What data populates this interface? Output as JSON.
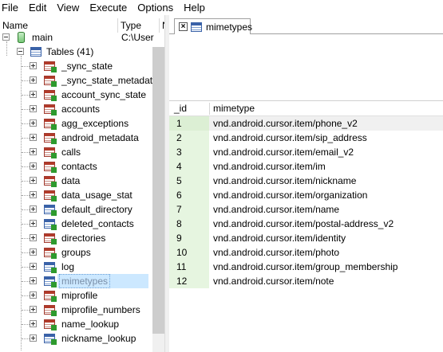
{
  "menu": [
    "File",
    "Edit",
    "View",
    "Execute",
    "Options",
    "Help"
  ],
  "tree_header": {
    "name": "Name",
    "type": "Type",
    "extra": "N"
  },
  "tree": {
    "db": {
      "label": "main",
      "type": "C:\\User"
    },
    "tables_node": "Tables (41)",
    "tables": [
      {
        "label": "_sync_state",
        "icon": "table-icon-red"
      },
      {
        "label": "_sync_state_metadata",
        "icon": "table-icon-red"
      },
      {
        "label": "account_sync_state",
        "icon": "table-icon-red"
      },
      {
        "label": "accounts",
        "icon": "table-icon-red"
      },
      {
        "label": "agg_exceptions",
        "icon": "table-icon-red"
      },
      {
        "label": "android_metadata",
        "icon": "table-icon-red"
      },
      {
        "label": "calls",
        "icon": "table-icon-red"
      },
      {
        "label": "contacts",
        "icon": "table-icon-red"
      },
      {
        "label": "data",
        "icon": "table-icon-red"
      },
      {
        "label": "data_usage_stat",
        "icon": "table-icon-red"
      },
      {
        "label": "default_directory",
        "icon": "table-icon-blue"
      },
      {
        "label": "deleted_contacts",
        "icon": "table-icon-blue"
      },
      {
        "label": "directories",
        "icon": "table-icon-red"
      },
      {
        "label": "groups",
        "icon": "table-icon-red"
      },
      {
        "label": "log",
        "icon": "table-icon-blue"
      },
      {
        "label": "mimetypes",
        "icon": "table-icon-blue",
        "selected": true
      },
      {
        "label": "miprofile",
        "icon": "table-icon-red"
      },
      {
        "label": "miprofile_numbers",
        "icon": "table-icon-red"
      },
      {
        "label": "name_lookup",
        "icon": "table-icon-red"
      },
      {
        "label": "nickname_lookup",
        "icon": "table-icon-blue"
      }
    ]
  },
  "tab": {
    "label": "mimetypes",
    "close_label": "×"
  },
  "grid": {
    "columns": [
      "_id",
      "mimetype"
    ],
    "rows": [
      [
        "1",
        "vnd.android.cursor.item/phone_v2"
      ],
      [
        "2",
        "vnd.android.cursor.item/sip_address"
      ],
      [
        "3",
        "vnd.android.cursor.item/email_v2"
      ],
      [
        "4",
        "vnd.android.cursor.item/im"
      ],
      [
        "5",
        "vnd.android.cursor.item/nickname"
      ],
      [
        "6",
        "vnd.android.cursor.item/organization"
      ],
      [
        "7",
        "vnd.android.cursor.item/name"
      ],
      [
        "8",
        "vnd.android.cursor.item/postal-address_v2"
      ],
      [
        "9",
        "vnd.android.cursor.item/identity"
      ],
      [
        "10",
        "vnd.android.cursor.item/photo"
      ],
      [
        "11",
        "vnd.android.cursor.item/group_membership"
      ],
      [
        "12",
        "vnd.android.cursor.item/note"
      ]
    ]
  },
  "colors": {
    "selection": "#cce8ff",
    "id_column": "#e6f5e0",
    "table_icon_blue": "#3a62a8",
    "table_icon_red": "#b23a2a"
  }
}
